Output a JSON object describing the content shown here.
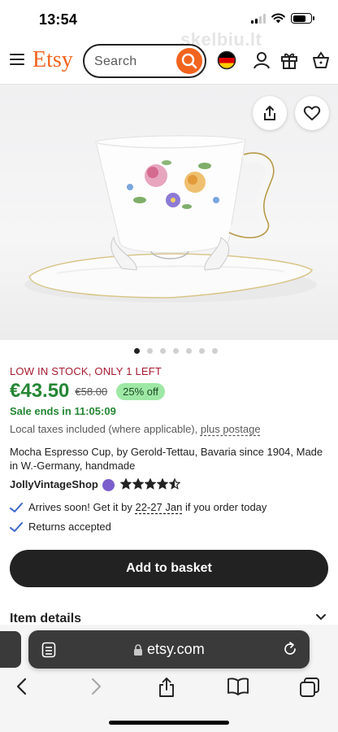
{
  "status_bar": {
    "time": "13:54"
  },
  "watermark": "skelbiu.lt",
  "header": {
    "logo": "Etsy",
    "search_placeholder": "Search",
    "icons": [
      "menu-icon",
      "search-icon",
      "germany-flag-icon",
      "account-icon",
      "gift-icon",
      "basket-icon"
    ]
  },
  "gallery": {
    "total_images": 7,
    "active_index": 0
  },
  "listing": {
    "stock_notice": "LOW IN STOCK, ONLY 1 LEFT",
    "price": "€43.50",
    "original_price": "€58.00",
    "discount": "25% off",
    "sale_ends": "Sale ends in 11:05:09",
    "taxes_prefix": "Local taxes included (where applicable), ",
    "postage_link": "plus postage",
    "title": "Mocha Espresso Cup, by Gerold-Tettau, Bavaria since 1904, Made in W.-Germany, handmade",
    "shop_name": "JollyVintageShop",
    "rating": 4.5,
    "arrival_prefix": "Arrives soon! Get it by ",
    "arrival_dates": "22-27 Jan",
    "arrival_suffix": " if you order today",
    "returns": "Returns accepted",
    "add_to_basket": "Add to basket",
    "item_details": "Item details"
  },
  "colors": {
    "brand": "#f1641e",
    "price_green": "#258635",
    "stock_red": "#a61a2e",
    "discount_bg": "#9ee8a5"
  },
  "browser": {
    "url": "etsy.com"
  }
}
